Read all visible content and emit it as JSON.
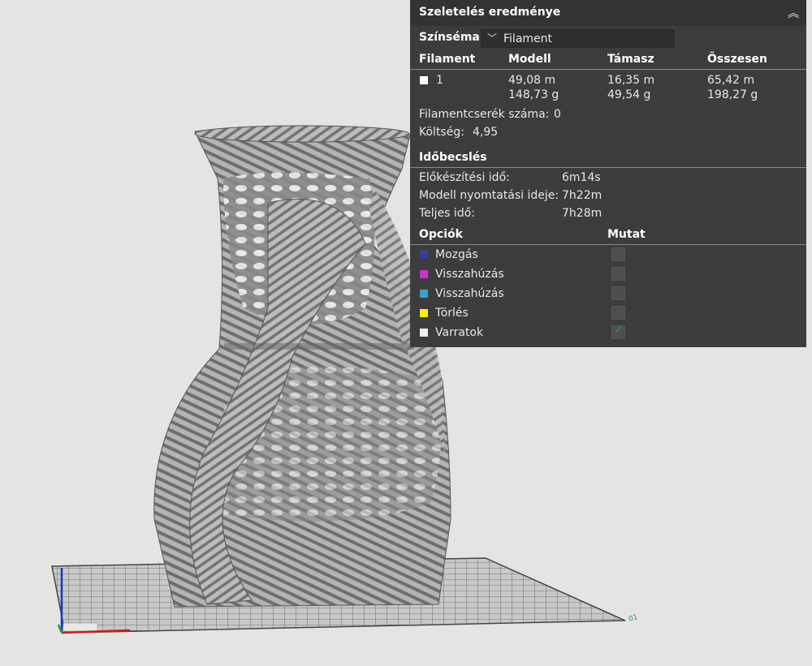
{
  "panel": {
    "title": "Szeletelés eredménye",
    "color_scheme_label": "Színséma",
    "color_scheme_value": "Filament",
    "table_headers": [
      "Filament",
      "Modell",
      "Támasz",
      "Összesen"
    ],
    "filament_row": {
      "id": "1",
      "model_length": "49,08 m",
      "model_weight": "148,73 g",
      "support_length": "16,35 m",
      "support_weight": "49,54 g",
      "total_length": "65,42 m",
      "total_weight": "198,27 g",
      "color": "#ffffff"
    },
    "filament_changes_label": "Filamentcserék száma:",
    "filament_changes_value": "0",
    "cost_label": "Költség:",
    "cost_value": "4,95",
    "time_header": "Időbecslés",
    "times": [
      {
        "label": "Előkészítési idő:",
        "value": "6m14s"
      },
      {
        "label": "Modell nyomtatási ideje:",
        "value": "7h22m"
      },
      {
        "label": "Teljes idő:",
        "value": "7h28m"
      }
    ],
    "options_header": "Opciók",
    "show_header": "Mutat",
    "options": [
      {
        "label": "Mozgás",
        "color": "#3c3c9c",
        "checked": false
      },
      {
        "label": "Visszahúzás",
        "color": "#cc33cc",
        "checked": false
      },
      {
        "label": "Visszahúzás",
        "color": "#39a0c8",
        "checked": false
      },
      {
        "label": "Törlés",
        "color": "#ffee00",
        "checked": false
      },
      {
        "label": "Varratok",
        "color": "#eeeeee",
        "checked": true
      }
    ]
  },
  "viewport": {
    "model_color": "#a8a8a8",
    "bed_color": "#c4c4c4",
    "bed_label": "01"
  }
}
